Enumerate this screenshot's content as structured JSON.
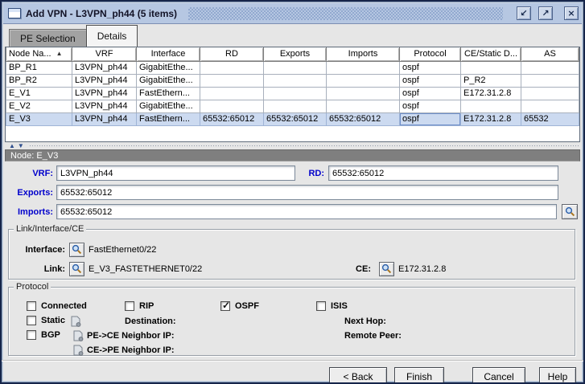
{
  "window": {
    "title": "Add VPN - L3VPN_ph44 (5 items)"
  },
  "icons": {
    "minimize": "↙",
    "maximize": "↗",
    "close": "×",
    "sort_ascending": "▲",
    "splitter_up": "▲",
    "splitter_down": "▼"
  },
  "colors": {
    "titlebar": "#b6c7e2",
    "selection": "#ccdaf0",
    "label_accent": "#0000cc",
    "node_header": "#7f7f7f"
  },
  "tabs": [
    {
      "label": "PE Selection",
      "selected": false
    },
    {
      "label": "Details",
      "selected": true
    }
  ],
  "table": {
    "columns": [
      "Node Na...",
      "VRF",
      "Interface",
      "RD",
      "Exports",
      "Imports",
      "Protocol",
      "CE/Static D...",
      "AS"
    ],
    "sorted_by": "Node Na...",
    "sort_direction": "ascending",
    "rows": [
      {
        "node": "BP_R1",
        "vrf": "L3VPN_ph44",
        "iface": "GigabitEthe...",
        "rd": "",
        "exports": "",
        "imports": "",
        "protocol": "ospf",
        "ce_static": "",
        "as": ""
      },
      {
        "node": "BP_R2",
        "vrf": "L3VPN_ph44",
        "iface": "GigabitEthe...",
        "rd": "",
        "exports": "",
        "imports": "",
        "protocol": "ospf",
        "ce_static": "P_R2",
        "as": ""
      },
      {
        "node": "E_V1",
        "vrf": "L3VPN_ph44",
        "iface": "FastEthern...",
        "rd": "",
        "exports": "",
        "imports": "",
        "protocol": "ospf",
        "ce_static": "E172.31.2.8",
        "as": ""
      },
      {
        "node": "E_V2",
        "vrf": "L3VPN_ph44",
        "iface": "GigabitEthe...",
        "rd": "",
        "exports": "",
        "imports": "",
        "protocol": "ospf",
        "ce_static": "",
        "as": ""
      },
      {
        "node": "E_V3",
        "vrf": "L3VPN_ph44",
        "iface": "FastEthern...",
        "rd": "65532:65012",
        "exports": "65532:65012",
        "imports": "65532:65012",
        "protocol": "ospf",
        "ce_static": "E172.31.2.8",
        "as": "65532",
        "selected": true
      }
    ]
  },
  "detail": {
    "header": "Node: E_V3",
    "vrf_label": "VRF:",
    "vrf_value": "L3VPN_ph44",
    "rd_label": "RD:",
    "rd_value": "65532:65012",
    "exports_label": "Exports:",
    "exports_value": "65532:65012",
    "imports_label": "Imports:",
    "imports_value": "65532:65012"
  },
  "link_group": {
    "title": "Link/Interface/CE",
    "interface_label": "Interface:",
    "interface_value": "FastEthernet0/22",
    "link_label": "Link:",
    "link_value": "E_V3_FASTETHERNET0/22",
    "ce_label": "CE:",
    "ce_value": "E172.31.2.8"
  },
  "protocol_group": {
    "title": "Protocol",
    "checkboxes": [
      {
        "label": "Connected",
        "checked": false
      },
      {
        "label": "RIP",
        "checked": false
      },
      {
        "label": "OSPF",
        "checked": true
      },
      {
        "label": "ISIS",
        "checked": false
      },
      {
        "label": "Static",
        "checked": false
      },
      {
        "label": "BGP",
        "checked": false
      }
    ],
    "destination_label": "Destination:",
    "next_hop_label": "Next Hop:",
    "pe_ce_label": "PE->CE Neighbor IP:",
    "remote_peer_label": "Remote Peer:",
    "ce_pe_label": "CE->PE Neighbor IP:"
  },
  "buttons": {
    "back": "< Back",
    "finish": "Finish",
    "cancel": "Cancel",
    "help": "Help"
  }
}
